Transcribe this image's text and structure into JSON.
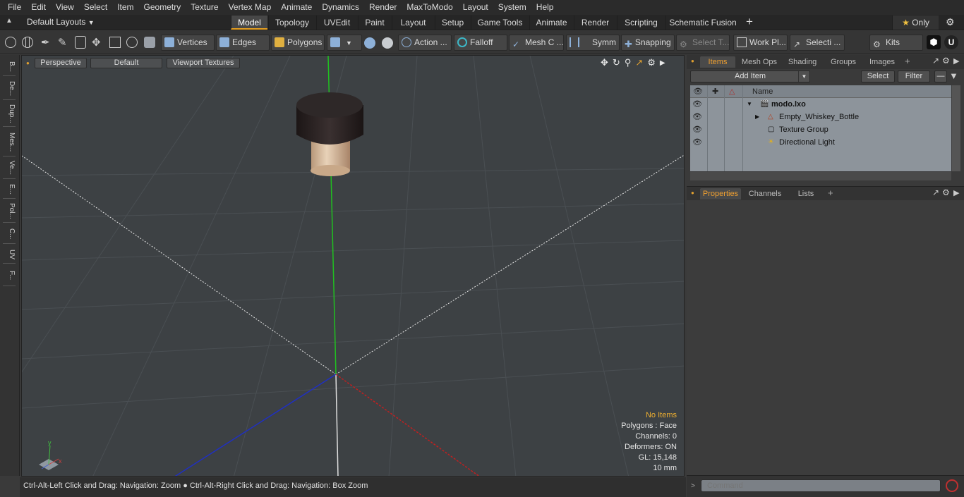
{
  "menu": [
    "File",
    "Edit",
    "View",
    "Select",
    "Item",
    "Geometry",
    "Texture",
    "Vertex Map",
    "Animate",
    "Dynamics",
    "Render",
    "MaxToModo",
    "Layout",
    "System",
    "Help"
  ],
  "layout_selector": "Default Layouts",
  "layout_tabs": [
    "Model",
    "Topology",
    "UVEdit",
    "Paint",
    "Layout",
    "Setup",
    "Game Tools",
    "Animate",
    "Render",
    "Scripting",
    "Schematic Fusion"
  ],
  "active_layout_tab": "Model",
  "only_label": "Only",
  "toolbar": {
    "vertices": "Vertices",
    "edges": "Edges",
    "polygons": "Polygons",
    "action": "Action ...",
    "falloff": "Falloff",
    "mesh_c": "Mesh C ...",
    "symm": "Symm ...",
    "snapping": "Snapping",
    "select_t": "Select T...",
    "work_pl": "Work Pl...",
    "selecti": "Selecti ...",
    "kits": "Kits"
  },
  "left_tabs": [
    "B...",
    "De...",
    "Dup...",
    "Mes...",
    "Ve...",
    "E...",
    "Pol...",
    "C...",
    "UV",
    "F..."
  ],
  "viewport": {
    "view_mode": "Perspective",
    "shading": "Default",
    "textures": "Viewport Textures",
    "info": [
      "No Items",
      "Polygons : Face",
      "Channels: 0",
      "Deformers: ON",
      "GL: 15,148",
      "10 mm"
    ]
  },
  "status": "Ctrl-Alt-Left Click and Drag: Navigation: Zoom ● Ctrl-Alt-Right Click and Drag: Navigation: Box Zoom",
  "items_panel": {
    "tabs": [
      "Items",
      "Mesh Ops",
      "Shading",
      "Groups",
      "Images"
    ],
    "add_item": "Add Item",
    "select": "Select",
    "filter": "Filter",
    "column_name": "Name",
    "rows": [
      {
        "label": "modo.lxo",
        "bold": true
      },
      {
        "label": "Empty_Whiskey_Bottle",
        "bold": false
      },
      {
        "label": "Texture Group",
        "bold": false
      },
      {
        "label": "Directional Light",
        "bold": false
      }
    ]
  },
  "properties_panel": {
    "tabs": [
      "Properties",
      "Channels",
      "Lists"
    ]
  },
  "command_placeholder": "Command",
  "colors": {
    "accent": "#e8a020",
    "axis_x": "#c02020",
    "axis_y": "#20c020",
    "axis_z": "#2030c0"
  }
}
